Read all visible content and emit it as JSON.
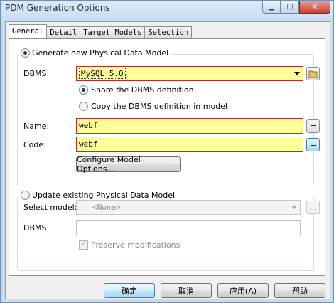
{
  "window": {
    "title": "PDM Generation Options",
    "minimize_glyph": "▁",
    "maximize_glyph": "□",
    "close_glyph": "✕"
  },
  "tabs": [
    "General",
    "Detail",
    "Target Models",
    "Selection"
  ],
  "generate_group": {
    "radio_label": "Generate new Physical Data Model",
    "dbms_label": "DBMS:",
    "dbms_value": "MySQL 5.0",
    "share_label": "Share the DBMS definition",
    "copy_label": "Copy the DBMS definition in model",
    "name_label": "Name:",
    "name_value": "webf",
    "code_label": "Code:",
    "code_value": "webf",
    "ellipsis_glyph": "=",
    "configure_button": "Configure Model Options..."
  },
  "update_group": {
    "radio_label": "Update existing Physical Data Model",
    "select_model_label": "Select model:",
    "select_model_value": "<None>",
    "browse_button": "...",
    "dbms_label": "DBMS:",
    "dbms_value": "",
    "preserve_label": "Preserve modifications"
  },
  "footer": {
    "ok": "确定",
    "cancel": "取消",
    "apply": "应用(A)",
    "help": "帮助"
  },
  "icons": {
    "folder": "folder-icon",
    "dropdown_arrow": "chevron-down-icon"
  },
  "colors": {
    "required_field_bg": "#ffff99",
    "required_field_border": "#bb2b2b"
  }
}
